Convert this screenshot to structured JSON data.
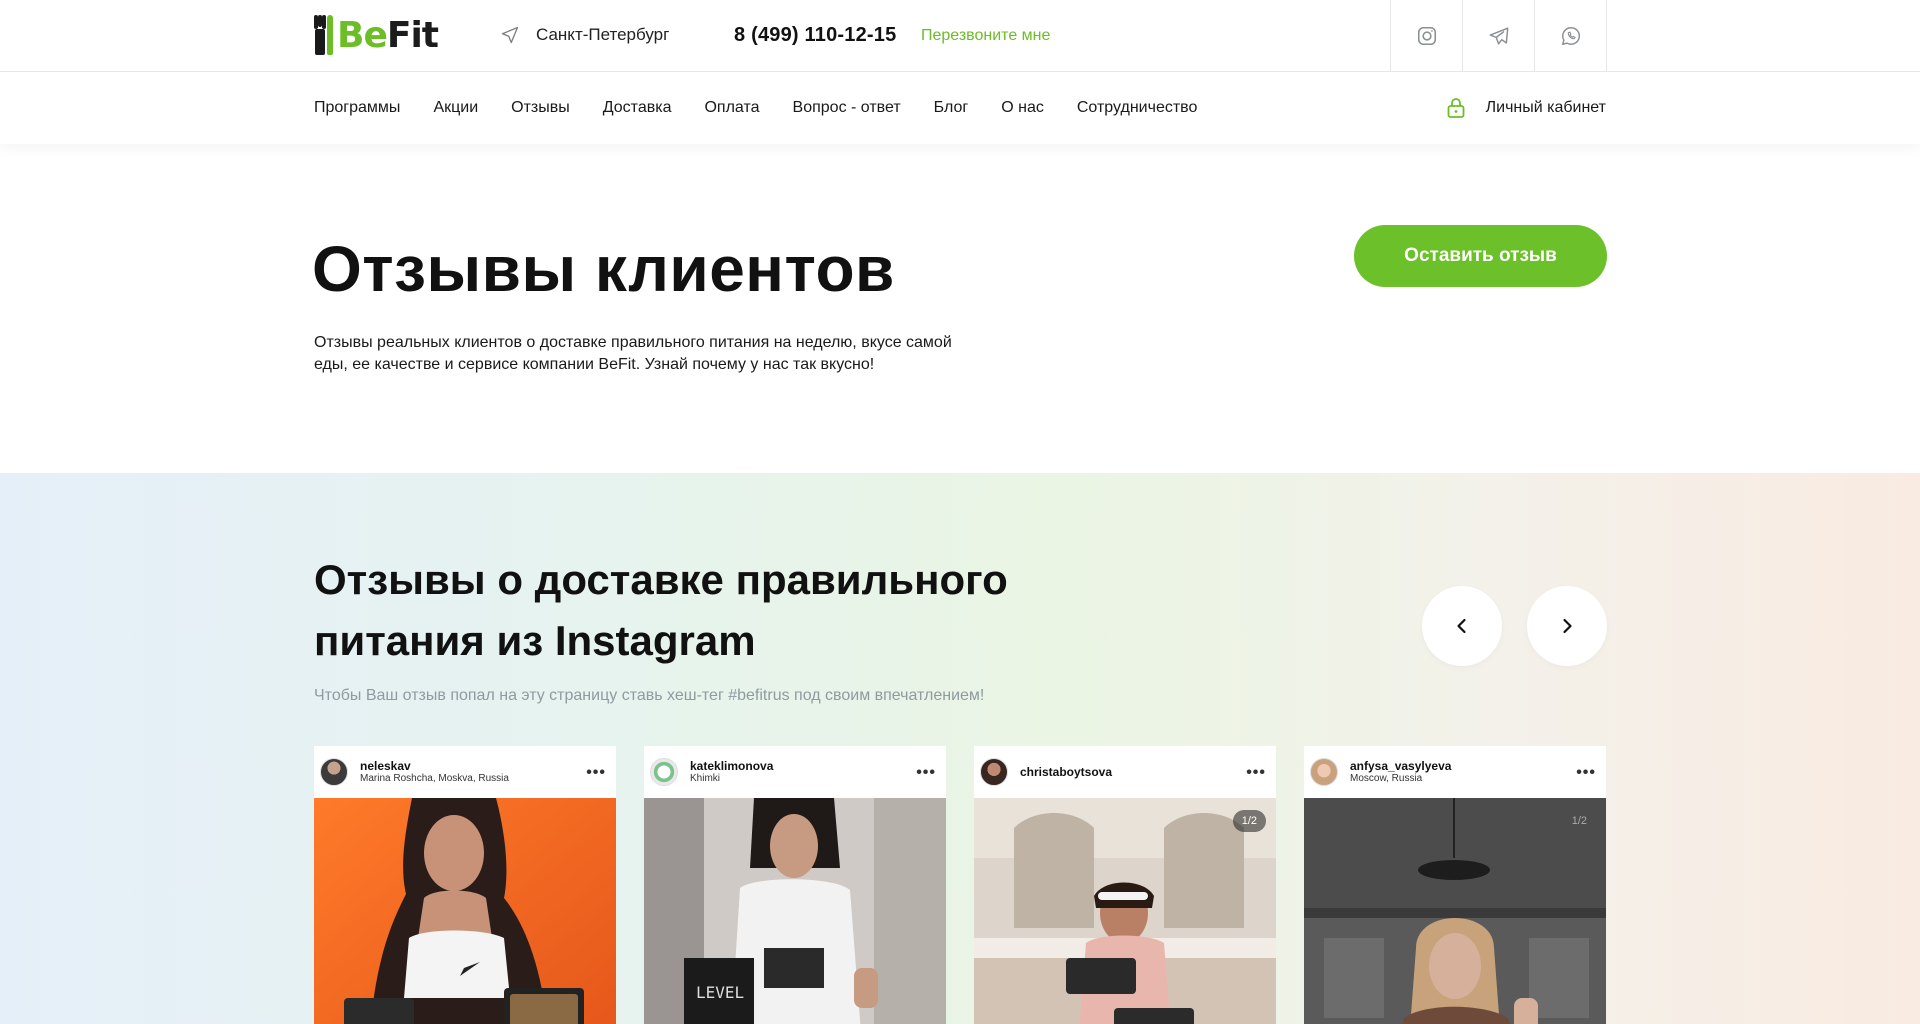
{
  "header": {
    "logo": {
      "be": "Be",
      "fit": "Fit"
    },
    "city": "Санкт-Петербург",
    "phone": "8 (499) 110-12-15",
    "callback": "Перезвоните мне",
    "socials": [
      "instagram-icon",
      "telegram-icon",
      "whatsapp-icon"
    ]
  },
  "nav": {
    "items": [
      "Программы",
      "Акции",
      "Отзывы",
      "Доставка",
      "Оплата",
      "Вопрос - ответ",
      "Блог",
      "О нас",
      "Сотрудничество"
    ],
    "account": "Личный кабинет"
  },
  "hero": {
    "title": "Отзывы клиентов",
    "description": "Отзывы реальных клиентов о доставке правильного питания на неделю, вкусе самой еды, ее качестве и сервисе компании BeFit. Узнай почему у нас так вкусно!",
    "cta": "Оставить отзыв"
  },
  "instagram": {
    "title": "Отзывы о доставке правильного питания из Instagram",
    "subtitle": "Чтобы Ваш отзыв попал на эту страницу ставь хеш-тег #befitrus под своим впечатлением!",
    "posts": [
      {
        "username": "neleskav",
        "location": "Marina Roshcha, Moskva, Russia",
        "counter": ""
      },
      {
        "username": "kateklimonova",
        "location": "Khimki",
        "counter": ""
      },
      {
        "username": "christaboytsova",
        "location": "",
        "counter": "1/2"
      },
      {
        "username": "anfysa_vasylyeva",
        "location": "Moscow, Russia",
        "counter": "1/2"
      }
    ]
  },
  "colors": {
    "accent": "#6cbd26",
    "text": "#111111",
    "muted": "#8f9aa1"
  }
}
